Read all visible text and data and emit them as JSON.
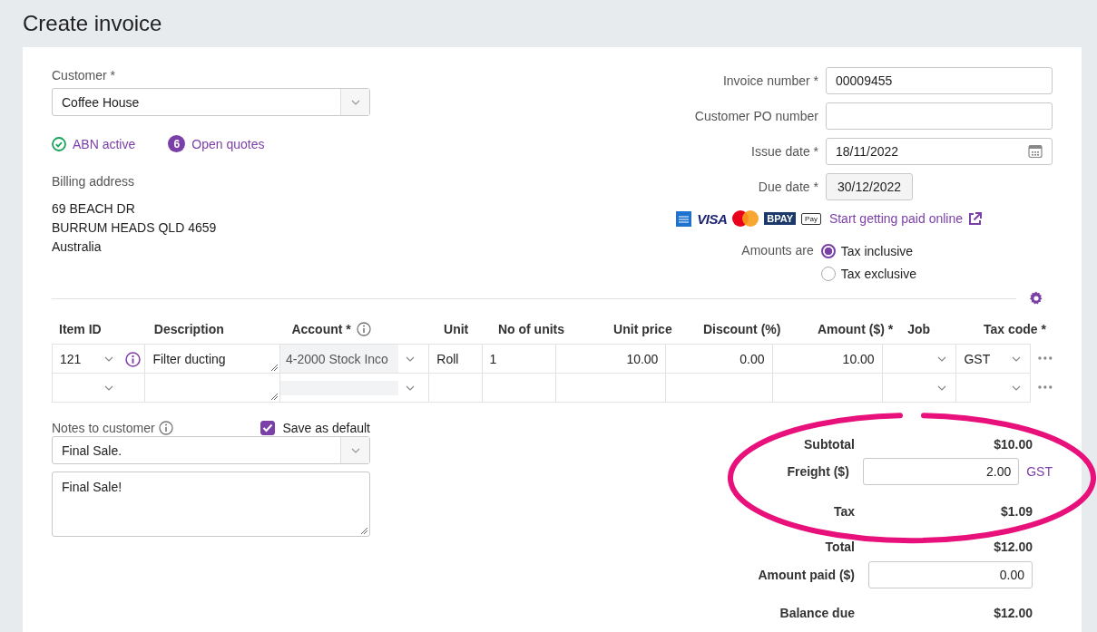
{
  "page_title": "Create invoice",
  "customer": {
    "label": "Customer *",
    "value": "Coffee House"
  },
  "abn_status": "ABN active",
  "open_quotes": {
    "count": "6",
    "label": "Open quotes"
  },
  "billing_address": {
    "label": "Billing address",
    "lines": [
      "69 BEACH DR",
      "BURRUM HEADS QLD 4659",
      "Australia"
    ]
  },
  "invoice_fields": [
    {
      "label": "Invoice number *",
      "kind": "text",
      "value": "00009455"
    },
    {
      "label": "Customer PO number",
      "kind": "text"
    },
    {
      "label": "Issue date *",
      "kind": "date",
      "value": "18/11/2022"
    },
    {
      "label": "Due date *",
      "kind": "button",
      "value": "30/12/2022"
    }
  ],
  "card_logos": [
    {
      "kind": "amex"
    },
    {
      "kind": "visa",
      "text": "VISA"
    },
    {
      "kind": "mastercard"
    },
    {
      "kind": "bpay",
      "text": "BPAY"
    },
    {
      "kind": "applepay",
      "text": "Pay"
    }
  ],
  "payment_link": "Start getting paid online",
  "amounts_are": {
    "label": "Amounts are",
    "options": [
      {
        "label": "Tax inclusive",
        "selected": true
      },
      {
        "label": "Tax exclusive",
        "selected": false
      }
    ]
  },
  "table": {
    "columns": [
      {
        "label": "Item ID",
        "kind": "select",
        "info": false
      },
      {
        "label": "Description",
        "kind": "textarea",
        "info": false
      },
      {
        "label": "Account *",
        "kind": "account",
        "info": true
      },
      {
        "label": "Unit",
        "kind": "text",
        "info": false
      },
      {
        "label": "No of units",
        "kind": "text",
        "info": false
      },
      {
        "label": "Unit price",
        "kind": "number",
        "info": false
      },
      {
        "label": "Discount (%)",
        "kind": "number",
        "info": false
      },
      {
        "label": "Amount ($) *",
        "kind": "number",
        "info": false
      },
      {
        "label": "Job",
        "kind": "select",
        "info": false
      },
      {
        "label": "Tax code *",
        "kind": "select",
        "info": false
      }
    ],
    "rows": [
      {
        "info": true,
        "cells": [
          "121",
          "Filter ducting",
          "4-2000  Stock Inco",
          "Roll",
          "1",
          "10.00",
          "0.00",
          "10.00",
          "",
          "GST"
        ]
      },
      {
        "info": false,
        "cells": [
          "",
          "",
          "",
          "",
          "",
          "",
          "",
          "",
          "",
          ""
        ]
      }
    ]
  },
  "notes": {
    "label": "Notes to customer",
    "save_default": {
      "label": "Save as default",
      "checked": true
    },
    "template": "Final Sale.",
    "text": "Final Sale!"
  },
  "totals": [
    {
      "label": "Subtotal",
      "kind": "text",
      "value": "$10.00"
    },
    {
      "label": "Freight ($)",
      "kind": "input",
      "value": "2.00",
      "tax_code": "GST"
    },
    {
      "label": "Tax",
      "kind": "text",
      "value": "$1.09"
    },
    {
      "label": "Total",
      "kind": "text",
      "value": "$12.00"
    },
    {
      "label": "Amount paid ($)",
      "kind": "input",
      "value": "0.00"
    },
    {
      "label": "Balance due",
      "kind": "text",
      "value": "$12.00"
    }
  ]
}
